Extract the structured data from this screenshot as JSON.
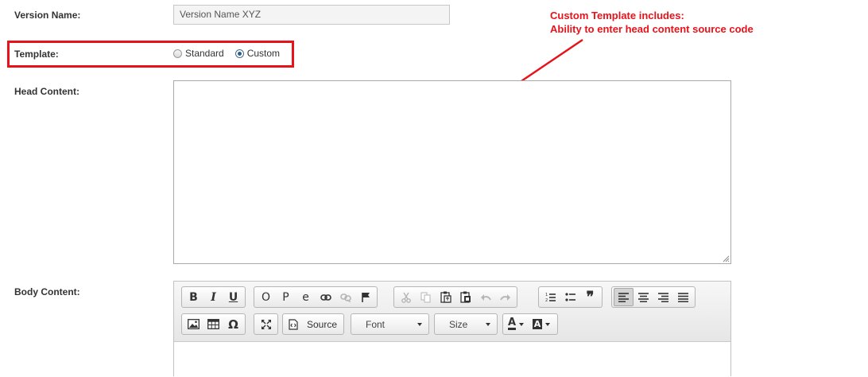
{
  "form": {
    "version_name_label": "Version Name:",
    "version_name_value": "Version Name XYZ",
    "template_label": "Template:",
    "template_options": [
      "Standard",
      "Custom"
    ],
    "template_selected": "Custom",
    "head_content_label": "Head Content:",
    "body_content_label": "Body Content:"
  },
  "annotation": {
    "line1": "Custom Template includes:",
    "line2": "Ability to enter head content source code",
    "color": "#e8121a"
  },
  "editor": {
    "source_label": "Source",
    "font_label": "Font",
    "size_label": "Size",
    "icons": {
      "bold": "B",
      "italic": "I",
      "underline": "U",
      "o_glyph": "O",
      "p_glyph": "P",
      "e_glyph": "e",
      "omega": "Ω",
      "quote": "❞",
      "text_color": "A",
      "bg_color": "A"
    }
  }
}
